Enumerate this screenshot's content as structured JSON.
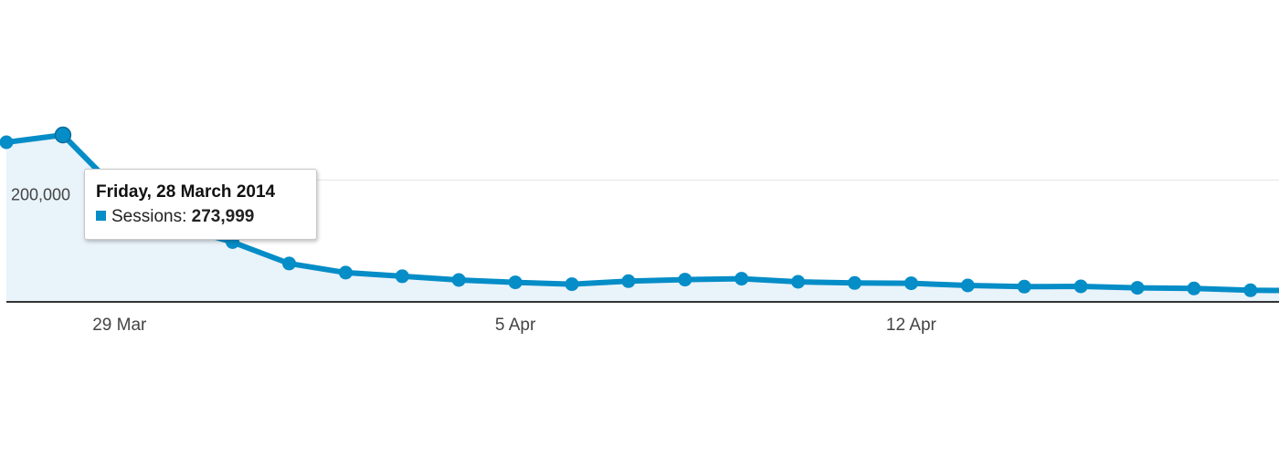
{
  "colors": {
    "line": "#058dc7",
    "area": "#e9f3fa",
    "grid": "#e4e4e4",
    "axis": "#333333",
    "tooltip_swatch": "#058dc7"
  },
  "chart_data": {
    "type": "area",
    "title": "",
    "xlabel": "",
    "ylabel": "",
    "ylim": [
      0,
      300000
    ],
    "y_ticks": [
      {
        "value": 200000,
        "label": "200,000"
      }
    ],
    "x_ticks": [
      {
        "date": "2014-03-29",
        "label": "29 Mar"
      },
      {
        "date": "2014-04-05",
        "label": "5 Apr"
      },
      {
        "date": "2014-04-12",
        "label": "12 Apr"
      }
    ],
    "grid": true,
    "series": [
      {
        "name": "Sessions",
        "x": [
          "2014-03-27",
          "2014-03-28",
          "2014-03-29",
          "2014-03-30",
          "2014-03-31",
          "2014-04-01",
          "2014-04-02",
          "2014-04-03",
          "2014-04-04",
          "2014-04-05",
          "2014-04-06",
          "2014-04-07",
          "2014-04-08",
          "2014-04-09",
          "2014-04-10",
          "2014-04-11",
          "2014-04-12",
          "2014-04-13",
          "2014-04-14",
          "2014-04-15",
          "2014-04-16",
          "2014-04-17",
          "2014-04-18",
          "2014-04-19"
        ],
        "values": [
          262000,
          273999,
          180000,
          125000,
          98000,
          63000,
          48000,
          42000,
          36000,
          32000,
          29000,
          34000,
          36500,
          38000,
          33000,
          31000,
          30500,
          27000,
          25000,
          25500,
          23000,
          22000,
          19000,
          18500
        ]
      }
    ]
  },
  "tooltip": {
    "title": "Friday, 28 March 2014",
    "series_label": "Sessions:",
    "value": "273,999"
  }
}
